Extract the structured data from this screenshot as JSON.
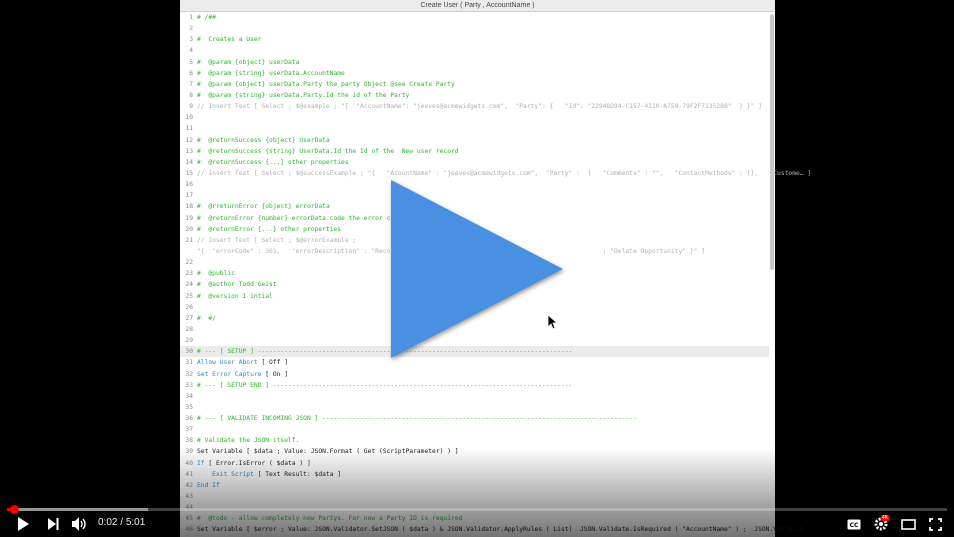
{
  "window_title": "Create User ( Party , AccountName )",
  "lines": [
    {
      "n": "1",
      "s": [
        {
          "t": "# /##",
          "c": "g"
        }
      ]
    },
    {
      "n": "2",
      "s": []
    },
    {
      "n": "3",
      "s": [
        {
          "t": "#  Creates a User",
          "c": "g"
        }
      ]
    },
    {
      "n": "4",
      "s": []
    },
    {
      "n": "5",
      "s": [
        {
          "t": "#  @param {object} userData",
          "c": "g"
        }
      ]
    },
    {
      "n": "6",
      "s": [
        {
          "t": "#  @param {string} userData.AccountName",
          "c": "g"
        }
      ]
    },
    {
      "n": "7",
      "s": [
        {
          "t": "#  @param {object} userData.Party the party Object @see Create Party",
          "c": "g"
        }
      ]
    },
    {
      "n": "8",
      "s": [
        {
          "t": "#  @param {string} userData.Party.Id the id of the Party",
          "c": "g"
        }
      ]
    },
    {
      "n": "9",
      "s": [
        {
          "t": "// Insert Text [ Select ; $@example ; \"{  \"AccountName\": \"jeeves@acmewidgets.com\",  \"Party\": {   \"Id\": \"22948D94-C157-4310-A759-79F2F713528B\"  } }\" ]",
          "c": "m"
        }
      ]
    },
    {
      "n": "10",
      "s": []
    },
    {
      "n": "11",
      "s": []
    },
    {
      "n": "12",
      "s": [
        {
          "t": "#  @returnSuccess {object} UserData",
          "c": "g"
        }
      ]
    },
    {
      "n": "13",
      "s": [
        {
          "t": "#  @returnSuccess {string} UserData.Id the Id of the  New user record",
          "c": "g"
        }
      ]
    },
    {
      "n": "14",
      "s": [
        {
          "t": "#  @returnSuccess {...} other properties",
          "c": "g"
        }
      ]
    },
    {
      "n": "15",
      "s": [
        {
          "t": "// Insert Text [ Select ; $@successExample ; \"{   \"AcountName\" : \"jeeves@acmewidgets.com\",  \"Party\" :  {   \"Comments\" : \"\",   \"ContactMethods\" : [],   \"Custome… ]",
          "c": "m"
        }
      ]
    },
    {
      "n": "16",
      "s": []
    },
    {
      "n": "17",
      "s": []
    },
    {
      "n": "18",
      "s": [
        {
          "t": "#  @rreturnError {object} errorData",
          "c": "g"
        }
      ]
    },
    {
      "n": "19",
      "s": [
        {
          "t": "#  @returnError {number} errorData.code the error code",
          "c": "g"
        }
      ]
    },
    {
      "n": "20",
      "s": [
        {
          "t": "#  @returnError {...} other properties",
          "c": "g"
        }
      ]
    },
    {
      "n": "21",
      "s": [
        {
          "t": "// Insert Text [ Select ; $@errorExample ;",
          "c": "m"
        }
      ]
    },
    {
      "n": "",
      "s": [
        {
          "t": "\"{  \"errorCode\" : 301,   \"errorDescription\" : \"Record                                                      ; \"Delete Opportunity\" }\" ]",
          "c": "m"
        }
      ]
    },
    {
      "n": "22",
      "s": []
    },
    {
      "n": "23",
      "s": [
        {
          "t": "#  @public",
          "c": "g"
        }
      ]
    },
    {
      "n": "24",
      "s": [
        {
          "t": "#  @author Todd Geist",
          "c": "g"
        }
      ]
    },
    {
      "n": "25",
      "s": [
        {
          "t": "#  @version 1 intial",
          "c": "g"
        }
      ]
    },
    {
      "n": "26",
      "s": []
    },
    {
      "n": "27",
      "s": [
        {
          "t": "#  #/",
          "c": "g"
        }
      ]
    },
    {
      "n": "28",
      "s": []
    },
    {
      "n": "29",
      "s": []
    },
    {
      "n": "30",
      "hl": true,
      "s": [
        {
          "t": "# --- [ SETUP ] -----------------------------------------------------------------------------------",
          "c": "g"
        }
      ]
    },
    {
      "n": "31",
      "s": [
        {
          "t": "Allow User Abort",
          "c": "k"
        },
        {
          "t": " [ Off ]",
          "c": "d"
        }
      ]
    },
    {
      "n": "32",
      "s": [
        {
          "t": "Set Error Capture",
          "c": "k"
        },
        {
          "t": " [ On ]",
          "c": "d"
        }
      ]
    },
    {
      "n": "33",
      "s": [
        {
          "t": "# --- [ SETUP END ] -------------------------------------------------------------------------------",
          "c": "g"
        }
      ]
    },
    {
      "n": "34",
      "s": []
    },
    {
      "n": "35",
      "s": []
    },
    {
      "n": "36",
      "s": [
        {
          "t": "# --- [ VALIDATE INCOMING JSON ] -----------------------------------------------------------------------------------",
          "c": "g"
        }
      ]
    },
    {
      "n": "37",
      "s": []
    },
    {
      "n": "38",
      "s": [
        {
          "t": "# Validate the JSON itself.",
          "c": "g"
        }
      ]
    },
    {
      "n": "39",
      "s": [
        {
          "t": "Set Variable [ $data ; Value: JSON.Format ( Get (ScriptParameter) ) ]",
          "c": "d"
        }
      ]
    },
    {
      "n": "40",
      "s": [
        {
          "t": "If",
          "c": "k"
        },
        {
          "t": " [ Error.IsError ( $data ) ]",
          "c": "d"
        }
      ]
    },
    {
      "n": "41",
      "s": [
        {
          "t": "    Exit Script",
          "c": "k"
        },
        {
          "t": " [ Text Result: $data ]",
          "c": "d"
        }
      ]
    },
    {
      "n": "42",
      "s": [
        {
          "t": "End If",
          "c": "k"
        }
      ]
    },
    {
      "n": "43",
      "s": []
    },
    {
      "n": "44",
      "s": []
    },
    {
      "n": "45",
      "s": [
        {
          "t": "#  @todo - allow completely new Partys. For now a Party ID is required",
          "c": "g"
        }
      ]
    },
    {
      "n": "46",
      "s": [
        {
          "t": "Set Variable [ $error ; Value: JSON.Validator.SetJSON ( $data ) & JSON.Validator.ApplyRules ( List(  JSON.Validate.IsRequired ( \"AccountName\" ) ;  JSON.Valid… ]",
          "c": "d"
        }
      ]
    }
  ],
  "player": {
    "current_time": "0:02",
    "separator": " / ",
    "duration": "5:01",
    "progress_played": 0.007,
    "progress_buffered": 0.15,
    "quality_badge": "4K",
    "play_color": "#4a90e2",
    "progress_color": "#ff0000"
  }
}
